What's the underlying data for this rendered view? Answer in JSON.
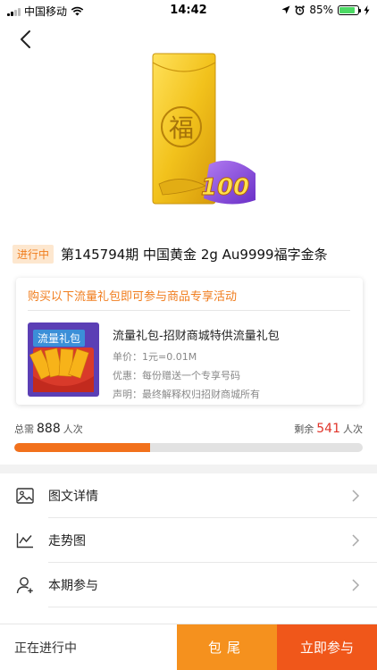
{
  "status_bar": {
    "carrier": "中国移动",
    "time": "14:42",
    "battery_percent": "85%",
    "battery_level": 0.85
  },
  "product": {
    "status_badge": "进行中",
    "title": "第145794期 中国黄金 2g Au9999福字金条",
    "image_char": "福",
    "image_badge": "100"
  },
  "promo": {
    "heading": "购买以下流量礼包即可参与商品专享活动",
    "gift_label": "流量礼包",
    "gift_name": "流量礼包-招财商城特供流量礼包",
    "unit_price": "单价：1元=0.01M",
    "discount": "优惠：每份赠送一个专享号码",
    "statement": "声明：最终解释权归招财商城所有"
  },
  "progress": {
    "total_prefix": "总需",
    "total_value": "888",
    "total_suffix": "人次",
    "remain_prefix": "剩余",
    "remain_value": "541",
    "remain_suffix": "人次",
    "filled_fraction": 0.39
  },
  "menu": {
    "items": [
      {
        "label": "图文详情"
      },
      {
        "label": "走势图"
      },
      {
        "label": "本期参与"
      }
    ]
  },
  "bottom_bar": {
    "status": "正在进行中",
    "baowei_label": "包尾",
    "join_label": "立即参与"
  },
  "colors": {
    "accent_orange": "#f07d1e",
    "progress_fill": "#f2711c",
    "remain_red": "#e0342a",
    "baowei_button": "#f5911e",
    "join_button": "#f0571a"
  }
}
